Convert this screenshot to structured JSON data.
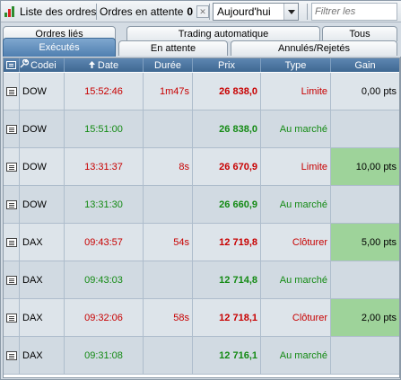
{
  "toolbar": {
    "orders_label": "Liste des ordres",
    "pending_label": "Ordres en attente",
    "pending_count": "0",
    "day_value": "Aujourd'hui",
    "filter_placeholder": "Filtrer les"
  },
  "tabs": {
    "row1": [
      "Ordres liés",
      "Trading automatique",
      "Tous"
    ],
    "row2": [
      "Exécutés",
      "En attente",
      "Annulés/Rejetés"
    ],
    "active": "Exécutés"
  },
  "columns": [
    "",
    "Codei",
    "Date",
    "Durée",
    "Prix",
    "Type",
    "Gain"
  ],
  "rows": [
    {
      "code": "DOW",
      "time": "15:52:46",
      "duration": "1m47s",
      "price": "26 838,0",
      "type": "Limite",
      "gain": "0,00 pts",
      "status": "closed",
      "gain_highlight": false
    },
    {
      "code": "DOW",
      "time": "15:51:00",
      "duration": "",
      "price": "26 838,0",
      "type": "Au marché",
      "gain": "",
      "status": "open",
      "gain_highlight": false
    },
    {
      "code": "DOW",
      "time": "13:31:37",
      "duration": "8s",
      "price": "26 670,9",
      "type": "Limite",
      "gain": "10,00 pts",
      "status": "closed",
      "gain_highlight": true
    },
    {
      "code": "DOW",
      "time": "13:31:30",
      "duration": "",
      "price": "26 660,9",
      "type": "Au marché",
      "gain": "",
      "status": "open",
      "gain_highlight": false
    },
    {
      "code": "DAX",
      "time": "09:43:57",
      "duration": "54s",
      "price": "12 719,8",
      "type": "Clôturer",
      "gain": "5,00 pts",
      "status": "closed",
      "gain_highlight": true
    },
    {
      "code": "DAX",
      "time": "09:43:03",
      "duration": "",
      "price": "12 714,8",
      "type": "Au marché",
      "gain": "",
      "status": "open",
      "gain_highlight": false
    },
    {
      "code": "DAX",
      "time": "09:32:06",
      "duration": "58s",
      "price": "12 718,1",
      "type": "Clôturer",
      "gain": "2,00 pts",
      "status": "closed",
      "gain_highlight": true
    },
    {
      "code": "DAX",
      "time": "09:31:08",
      "duration": "",
      "price": "12 716,1",
      "type": "Au marché",
      "gain": "",
      "status": "open",
      "gain_highlight": false
    }
  ],
  "colors": {
    "closed": "#c80000",
    "open": "#138a13",
    "gain_highlight": "#9ed39a",
    "header": "#4f7fb0"
  }
}
